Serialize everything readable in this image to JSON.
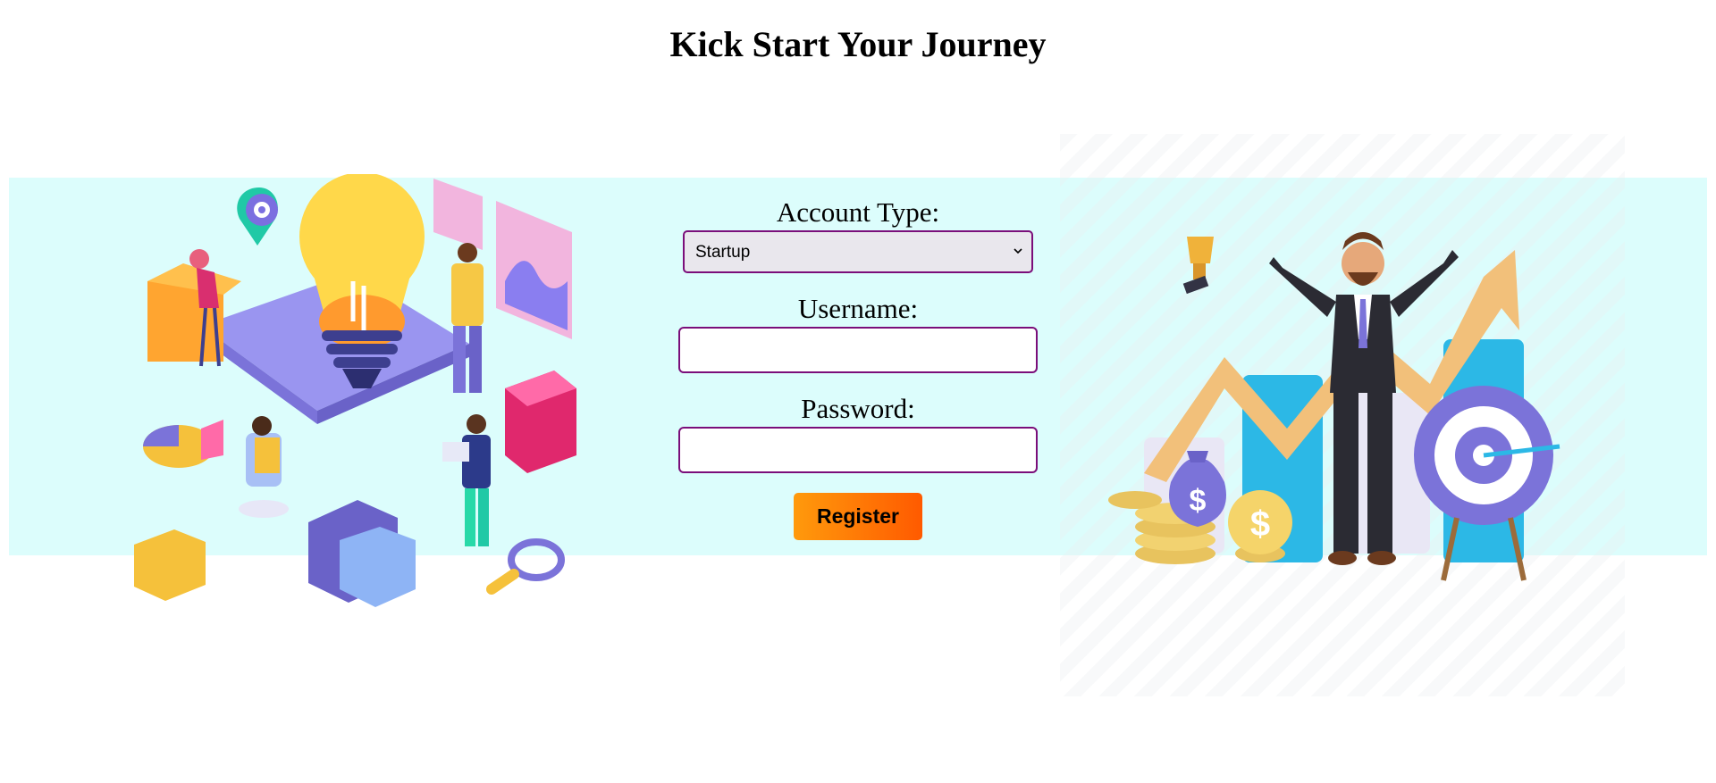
{
  "page": {
    "title": "Kick Start Your Journey"
  },
  "form": {
    "account_type_label": "Account Type:",
    "account_type_value": "Startup",
    "username_label": "Username:",
    "username_value": "",
    "password_label": "Password:",
    "password_value": "",
    "register_label": "Register"
  },
  "colors": {
    "band": "#dcfdfc",
    "input_border": "#7a0e7a",
    "button_gradient_start": "#ff9a0c",
    "button_gradient_end": "#ff5a00"
  },
  "icons": {
    "left_illustration": "startup-teamwork-illustration",
    "right_illustration": "success-businessman-illustration",
    "dropdown": "chevron-down-icon",
    "coin_symbol": "$"
  }
}
